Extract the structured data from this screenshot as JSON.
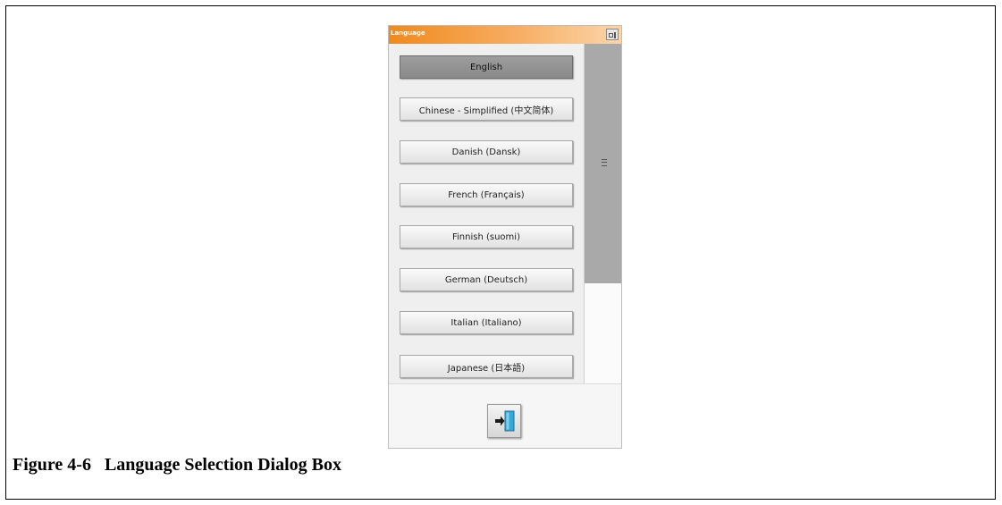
{
  "dialog": {
    "title": "Language",
    "languages": [
      {
        "label": "English",
        "selected": true
      },
      {
        "label": "Chinese - Simplified (中文简体)",
        "selected": false
      },
      {
        "label": "Danish (Dansk)",
        "selected": false
      },
      {
        "label": "French (Français)",
        "selected": false
      },
      {
        "label": "Finnish (suomi)",
        "selected": false
      },
      {
        "label": "German (Deutsch)",
        "selected": false
      },
      {
        "label": "Italian (Italiano)",
        "selected": false
      },
      {
        "label": "Japanese (日本語)",
        "selected": false
      }
    ],
    "icons": {
      "window": "window-icon",
      "exit": "exit-door-icon"
    }
  },
  "caption": {
    "figure_number": "Figure 4-6",
    "text": "Language Selection Dialog Box"
  },
  "colors": {
    "titlebar": "#f08a1d",
    "selected_button": "#8f8f8f",
    "scroll_thumb": "#a9a9a9"
  }
}
